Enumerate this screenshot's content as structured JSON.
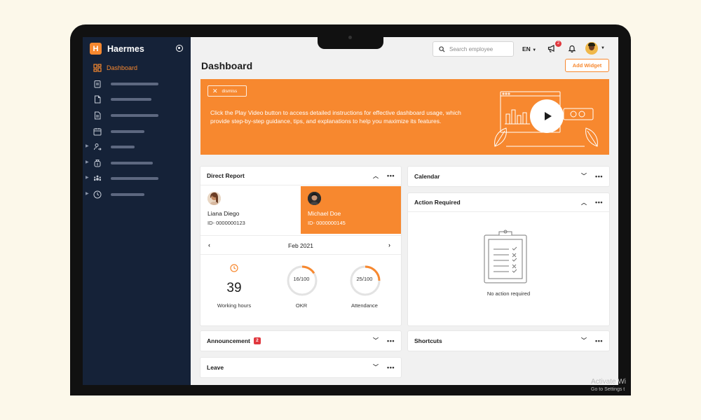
{
  "app": {
    "name": "Haermes",
    "logo_letter": "H"
  },
  "sidebar": {
    "items": [
      {
        "label": "Dashboard",
        "icon": "dashboard-icon",
        "active": true
      },
      {
        "label": "",
        "icon": "clipboard-icon"
      },
      {
        "label": "",
        "icon": "document-icon"
      },
      {
        "label": "",
        "icon": "file-text-icon"
      },
      {
        "label": "",
        "icon": "calendar-icon"
      },
      {
        "label": "",
        "icon": "user-transfer-icon",
        "expandable": true
      },
      {
        "label": "",
        "icon": "money-bag-icon",
        "expandable": true
      },
      {
        "label": "",
        "icon": "team-icon",
        "expandable": true
      },
      {
        "label": "",
        "icon": "clock-icon",
        "expandable": true
      }
    ]
  },
  "topbar": {
    "search_placeholder": "Search employee",
    "language": "EN",
    "announcement_count": "2"
  },
  "page": {
    "title": "Dashboard",
    "add_widget_label": "Add Widget"
  },
  "banner": {
    "dismiss_label": "dismiss",
    "text": "Click the Play Video button to access detailed instructions for effective dashboard usage, which provide step-by-step guidance, tips, and explanations to help you maximize its features."
  },
  "direct_report": {
    "title": "Direct Report",
    "people": [
      {
        "name": "Liana Diego",
        "id": "ID- 0000000123",
        "selected": false
      },
      {
        "name": "Michael Doe",
        "id": "ID- 0000000145",
        "selected": true
      }
    ],
    "month": "Feb 2021",
    "stats": {
      "hours_value": "39",
      "hours_label": "Working hours",
      "okr_value": "16/100",
      "okr_fraction": 0.16,
      "okr_label": "OKR",
      "attendance_value": "25/100",
      "attendance_fraction": 0.25,
      "attendance_label": "Attendance"
    }
  },
  "calendar": {
    "title": "Calendar"
  },
  "action_required": {
    "title": "Action Required",
    "empty_text": "No action required"
  },
  "announcement": {
    "title": "Announcement",
    "count": "2"
  },
  "shortcuts": {
    "title": "Shortcuts"
  },
  "leave": {
    "title": "Leave"
  },
  "watermark": {
    "line1": "Activate Wi",
    "line2": "Go to Settings t"
  },
  "colors": {
    "accent": "#f7882f",
    "sidebar_bg": "#152238",
    "badge": "#e0383e"
  }
}
